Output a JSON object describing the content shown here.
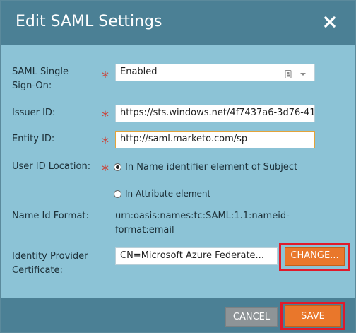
{
  "dialog": {
    "title": "Edit SAML Settings",
    "close_icon": "close-icon"
  },
  "form": {
    "sso": {
      "label_line1": "SAML Single",
      "label_line2": "Sign-On:",
      "value": "Enabled"
    },
    "issuer": {
      "label": "Issuer ID:",
      "value": "https://sts.windows.net/4f7437a6-3d76-41"
    },
    "entity": {
      "label": "Entity ID:",
      "value": "http://saml.marketo.com/sp"
    },
    "user_id_location": {
      "label": "User ID Location:",
      "options": [
        "In Name identifier element of Subject",
        "In Attribute element"
      ],
      "selected": "In Name identifier element of Subject"
    },
    "name_id_format": {
      "label": "Name Id Format:",
      "value_line1": "urn:oasis:names:tc:SAML:1.1:nameid-",
      "value_line2": "format:email"
    },
    "certificate": {
      "label_line1": "Identity Provider",
      "label_line2": "Certificate:",
      "value": "CN=Microsoft Azure Federate...",
      "change_label": "CHANGE..."
    },
    "required_marker": "*"
  },
  "footer": {
    "cancel_label": "CANCEL",
    "save_label": "SAVE"
  },
  "colors": {
    "header": "#4b8095",
    "body": "#8cc3d6",
    "accent": "#e9772b",
    "highlight": "#e01a2b",
    "required": "#c9463d"
  }
}
